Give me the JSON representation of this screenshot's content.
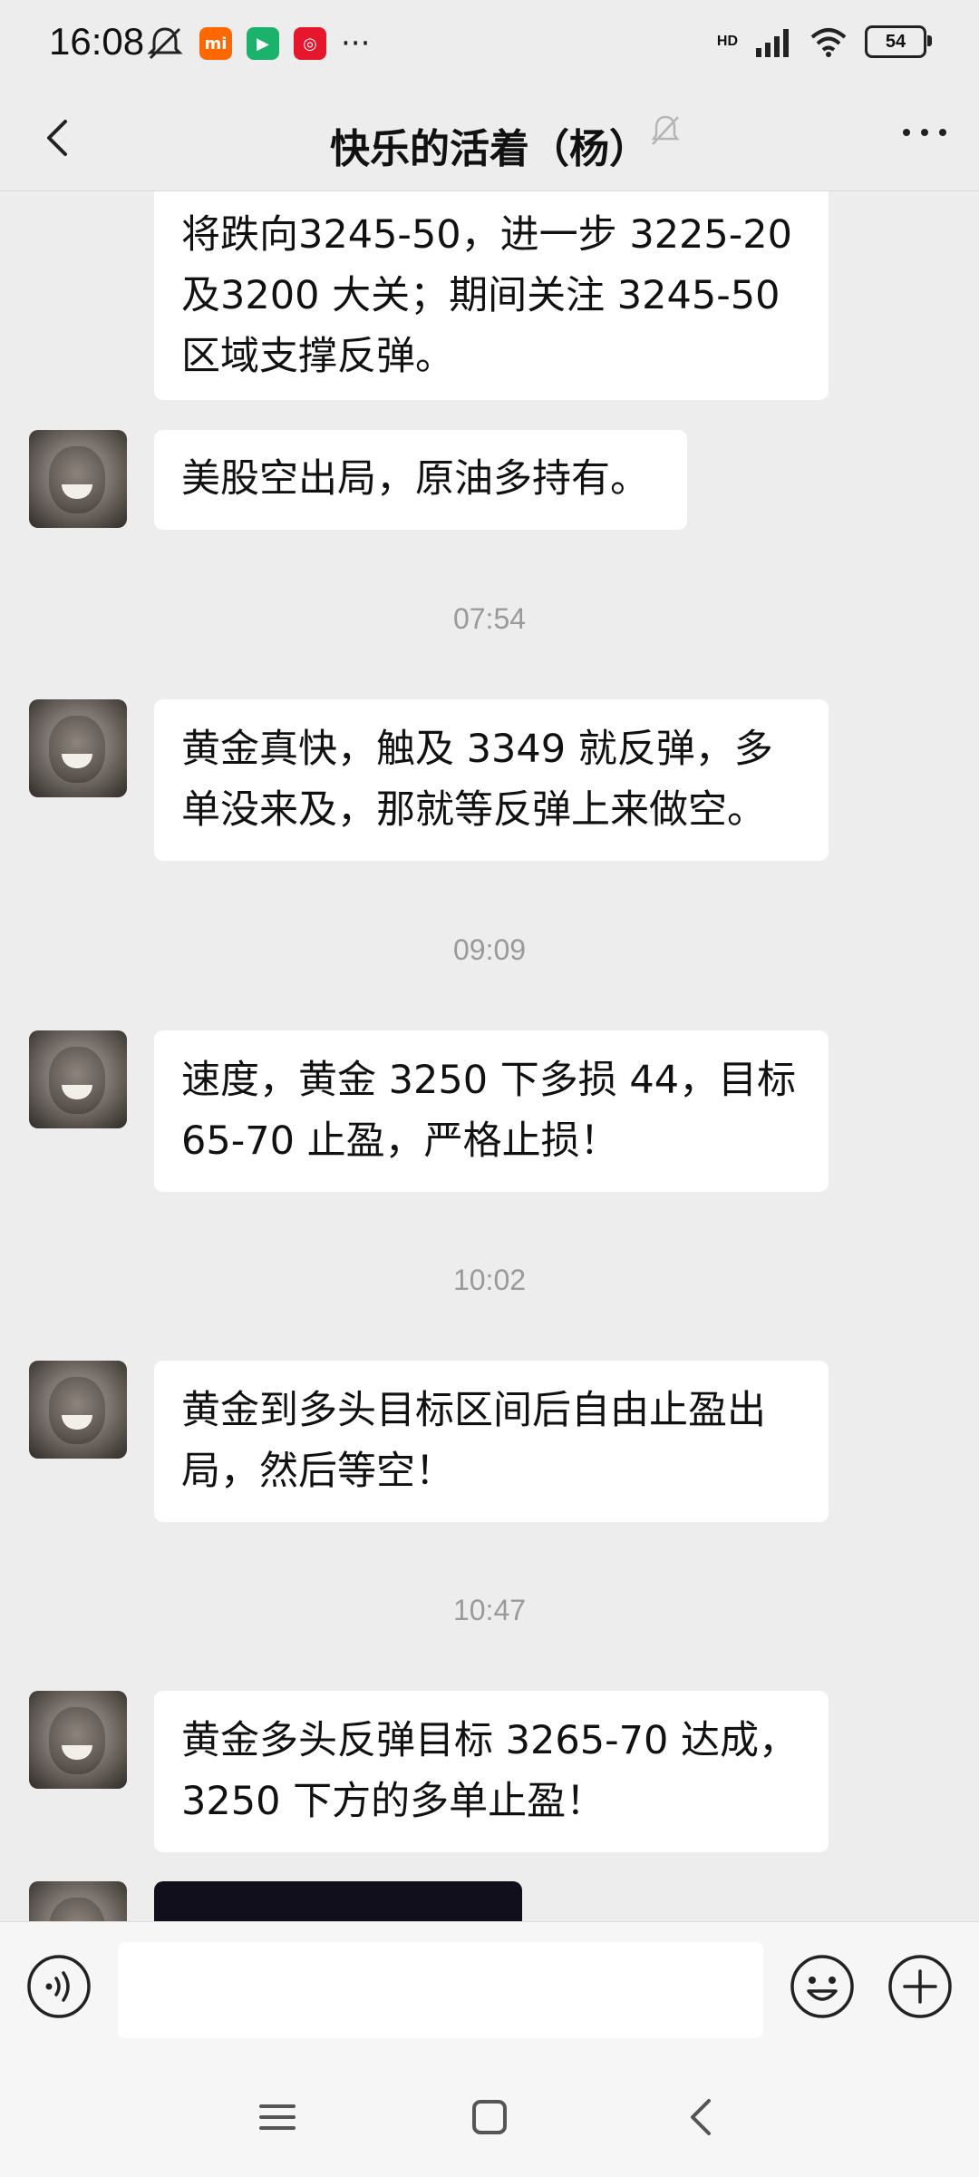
{
  "status_bar": {
    "time": "16:08",
    "network": "HD",
    "battery": "54",
    "app_badges": [
      "mi-icon",
      "video-app-icon",
      "weibo-icon"
    ],
    "overflow": "···"
  },
  "header": {
    "title": "快乐的活着（杨）",
    "back_icon": "chevron-left-icon",
    "mute_icon": "bell-muted-icon",
    "more_icon": "more-dots-icon"
  },
  "messages": [
    {
      "type": "text",
      "lines": [
        "将跌向3245-50，进一步 3225-20",
        "及3200 大关；期间关注 3245-50",
        "区域支撑反弹。"
      ]
    },
    {
      "type": "text",
      "lines": [
        "美股空出局，原油多持有。"
      ]
    },
    {
      "type": "timestamp",
      "text": "07:54"
    },
    {
      "type": "text",
      "lines": [
        "黄金真快，触及 3349 就反弹，多",
        "单没来及，那就等反弹上来做空。"
      ]
    },
    {
      "type": "timestamp",
      "text": "09:09"
    },
    {
      "type": "text",
      "lines": [
        "速度，黄金 3250 下多损 44，目标",
        "65-70 止盈，严格止损！"
      ]
    },
    {
      "type": "timestamp",
      "text": "10:02"
    },
    {
      "type": "text",
      "lines": [
        "黄金到多头目标区间后自由止盈出",
        "局，然后等空！"
      ]
    },
    {
      "type": "timestamp",
      "text": "10:47"
    },
    {
      "type": "text",
      "lines": [
        "黄金多头反弹目标 3265-70 达成，",
        "3250 下方的多单止盈！"
      ]
    }
  ],
  "input_bar": {
    "placeholder": "",
    "voice_icon": "voice-icon",
    "emoji_icon": "emoji-icon",
    "plus_icon": "plus-icon"
  },
  "nav_bar": {
    "menu_icon": "menu-icon",
    "home_icon": "home-icon",
    "back_icon": "back-icon"
  },
  "colors": {
    "background": "#ededed",
    "bubble": "#ffffff",
    "timestamp": "#9a9a9a"
  }
}
